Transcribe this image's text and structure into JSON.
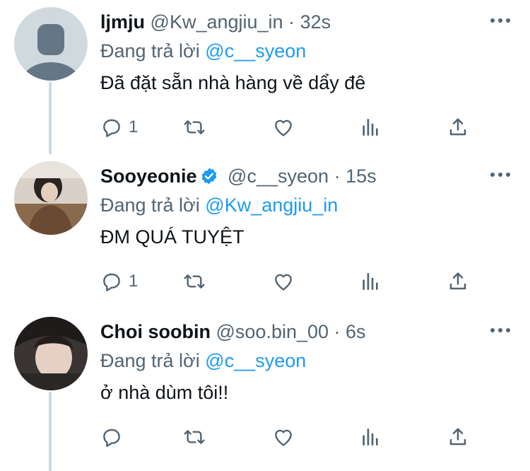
{
  "tweets": [
    {
      "name": "ljmju",
      "handle": "@Kw_angjiu_in",
      "time": "· 32s",
      "replying_prefix": "Đang trả lời",
      "replying_to": "@c__syeon",
      "text": "Đã đặt sẵn nhà hàng về dẩy đê",
      "reply_count": "1",
      "verified": false,
      "avatar": "default-profile"
    },
    {
      "name": "Sooyeonie",
      "handle": "@c__syeon",
      "time": "· 15s",
      "replying_prefix": "Đang trả lời",
      "replying_to": "@Kw_angjiu_in",
      "text": "ĐM QUÁ TUYỆT",
      "reply_count": "1",
      "verified": true,
      "avatar": "photo"
    },
    {
      "name": "Choi soobin",
      "handle": "@soo.bin_00",
      "time": "· 6s",
      "replying_prefix": "Đang trả lời",
      "replying_to": "@c__syeon",
      "text": "ở nhà dùm tôi!!",
      "reply_count": "",
      "verified": false,
      "avatar": "photo"
    }
  ],
  "icons": {
    "reply": "reply-icon",
    "retweet": "retweet-icon",
    "like": "heart-icon",
    "stats": "analytics-icon",
    "share": "share-icon",
    "more": "more-icon",
    "verified": "verified-badge-icon"
  },
  "colors": {
    "link": "#1d9bf0",
    "secondary": "#536471",
    "text": "#0f1419",
    "thread_line": "#cfd9de"
  }
}
